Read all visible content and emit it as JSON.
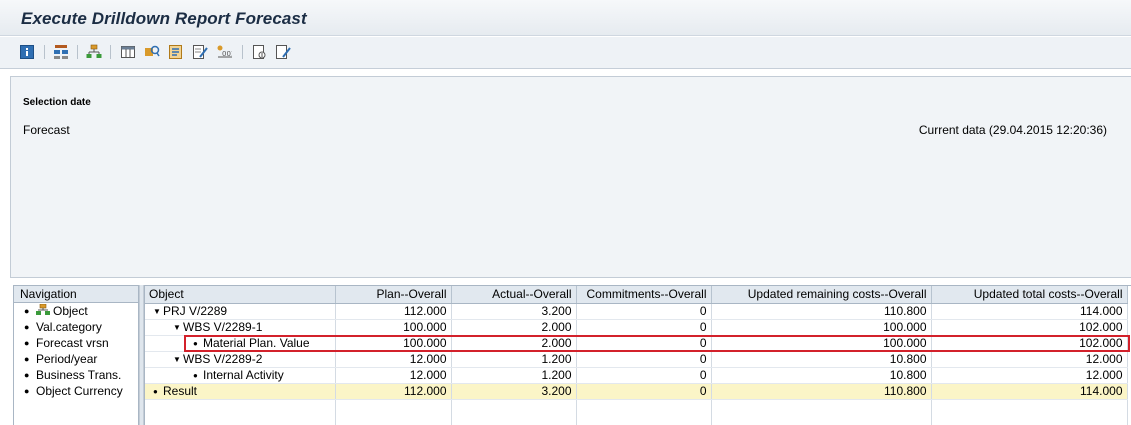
{
  "window": {
    "title": "Execute Drilldown Report Forecast"
  },
  "toolbar": {
    "buttons": [
      {
        "name": "info-icon",
        "glyph": "i"
      },
      {
        "name": "hierarchy-icon"
      },
      {
        "name": "org-structure-icon"
      },
      {
        "name": "columns-icon"
      },
      {
        "name": "find-icon"
      },
      {
        "name": "sort-icon"
      },
      {
        "name": "edit-icon"
      },
      {
        "name": "variables-icon"
      },
      {
        "name": "export-icon"
      },
      {
        "name": "change-layout-icon"
      }
    ]
  },
  "header": {
    "selection_date_label": "Selection date",
    "forecast_label": "Forecast",
    "current_data": "Current data (29.04.2015 12:20:36)"
  },
  "navigation": {
    "title": "Navigation",
    "items": [
      {
        "label": "Object",
        "icon": "hierarchy-icon"
      },
      {
        "label": "Val.category"
      },
      {
        "label": "Forecast vrsn"
      },
      {
        "label": "Period/year"
      },
      {
        "label": "Business Trans."
      },
      {
        "label": "Object Currency"
      }
    ]
  },
  "grid": {
    "columns": [
      "Object",
      "Plan--Overall",
      "Actual--Overall",
      "Commitments--Overall",
      "Updated remaining costs--Overall",
      "Updated total costs--Overall"
    ],
    "rows": [
      {
        "object": "PRJ V/2289",
        "plan": "112.000",
        "actual": "3.200",
        "commit": "0",
        "remaining": "110.800",
        "total": "114.000"
      },
      {
        "object": "WBS V/2289-1",
        "plan": "100.000",
        "actual": "2.000",
        "commit": "0",
        "remaining": "100.000",
        "total": "102.000"
      },
      {
        "object": "Material Plan. Value",
        "plan": "100.000",
        "actual": "2.000",
        "commit": "0",
        "remaining": "100.000",
        "total": "102.000"
      },
      {
        "object": "WBS V/2289-2",
        "plan": "12.000",
        "actual": "1.200",
        "commit": "0",
        "remaining": "10.800",
        "total": "12.000"
      },
      {
        "object": "Internal Activity",
        "plan": "12.000",
        "actual": "1.200",
        "commit": "0",
        "remaining": "10.800",
        "total": "12.000"
      },
      {
        "object": "Result",
        "plan": "112.000",
        "actual": "3.200",
        "commit": "0",
        "remaining": "110.800",
        "total": "114.000"
      }
    ]
  },
  "colors": {
    "highlight": "#d3212b",
    "result_row": "#fbf5c7",
    "header_bg": "#e1e8ef"
  }
}
